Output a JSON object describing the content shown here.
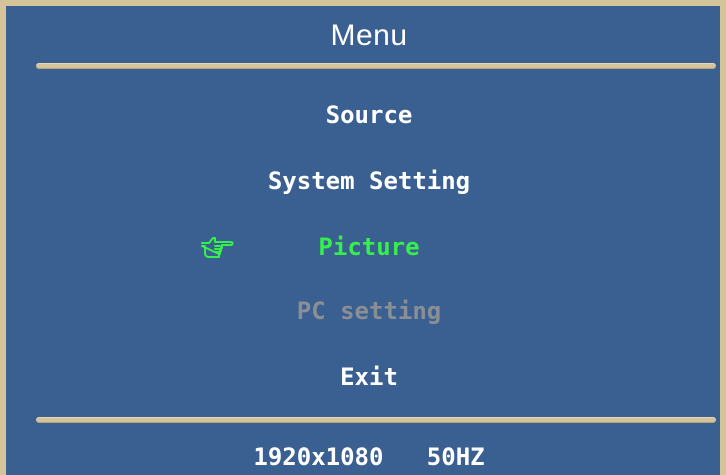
{
  "osd": {
    "title": "Menu",
    "items": [
      {
        "label": "Source",
        "state": "normal"
      },
      {
        "label": "System Setting",
        "state": "normal"
      },
      {
        "label": "Picture",
        "state": "selected"
      },
      {
        "label": "PC setting",
        "state": "disabled"
      },
      {
        "label": "Exit",
        "state": "normal"
      }
    ],
    "status": {
      "resolution": "1920x1080",
      "refresh_rate": "50HZ"
    }
  },
  "icons": {
    "pointer": "pointing-hand-icon"
  },
  "colors": {
    "background": "#3a5f91",
    "frame": "#d5c39a",
    "text": "#ffffff",
    "selected": "#35f04c",
    "disabled": "#8a8f96"
  }
}
